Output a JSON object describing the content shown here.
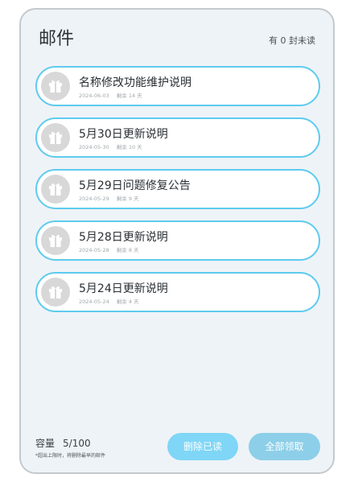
{
  "header": {
    "title": "邮件",
    "unread_text": "有 0 封未读"
  },
  "mails": [
    {
      "title": "名称修改功能维护说明",
      "date": "2024-06-03",
      "remaining": "剩余 14 天"
    },
    {
      "title": "5月30日更新说明",
      "date": "2024-05-30",
      "remaining": "剩余 10 天"
    },
    {
      "title": "5月29日问题修复公告",
      "date": "2024-05-29",
      "remaining": "剩余 9 天"
    },
    {
      "title": "5月28日更新说明",
      "date": "2024-05-28",
      "remaining": "剩余 8 天"
    },
    {
      "title": "5月24日更新说明",
      "date": "2024-05-24",
      "remaining": "剩余 4 天"
    }
  ],
  "footer": {
    "capacity_label": "容量",
    "capacity_value": "5/100",
    "note": "*超出上限时，将删除最早的邮件",
    "delete_read_label": "删除已读",
    "claim_all_label": "全部领取"
  },
  "icons": {
    "mail_item_icon": "gift-icon"
  },
  "colors": {
    "item_border": "#5ecbee",
    "primary_button": "#7fd6f6",
    "panel_bg": "#eef3f7"
  }
}
